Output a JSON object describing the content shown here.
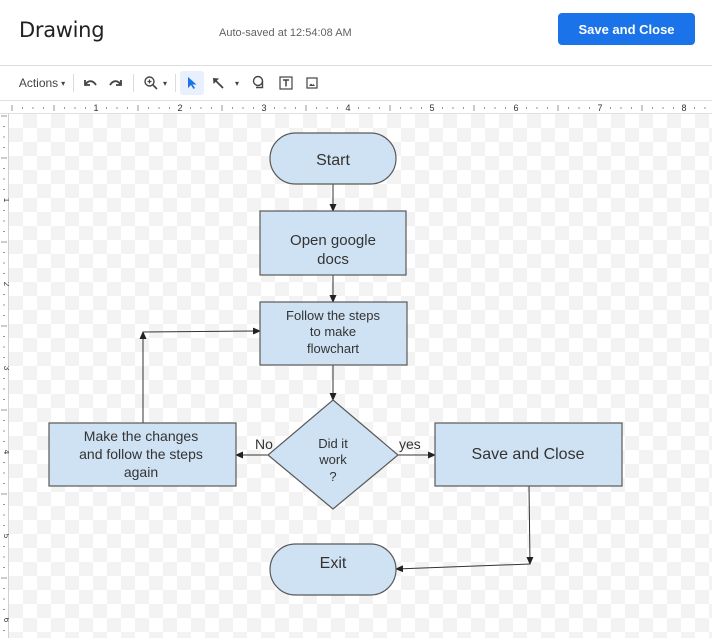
{
  "header": {
    "title": "Drawing",
    "autosave_status": "Auto-saved at 12:54:08 AM",
    "save_close_label": "Save and Close"
  },
  "toolbar": {
    "actions_label": "Actions",
    "icons": [
      "undo-icon",
      "redo-icon",
      "zoom-icon",
      "select-icon",
      "line-icon",
      "shape-icon",
      "textbox-icon",
      "image-icon"
    ]
  },
  "ruler": {
    "horizontal_labels": [
      "1",
      "2",
      "3",
      "4",
      "5",
      "6",
      "7",
      "8"
    ],
    "vertical_labels": [
      "1",
      "2",
      "3",
      "4",
      "5",
      "6"
    ]
  },
  "flowchart": {
    "fill_color": "#cfe2f3",
    "stroke_color": "#595959",
    "nodes": {
      "start": "Start",
      "open_docs": [
        "Open google",
        "docs"
      ],
      "follow_steps": [
        "Follow the steps",
        "to make",
        "flowchart"
      ],
      "decision": [
        "Did it",
        "work",
        "?"
      ],
      "make_changes": [
        "Make the changes",
        "and follow the steps",
        "again"
      ],
      "save_close": "Save and Close",
      "exit": "Exit"
    },
    "edge_labels": {
      "no": "No",
      "yes": "yes"
    }
  }
}
